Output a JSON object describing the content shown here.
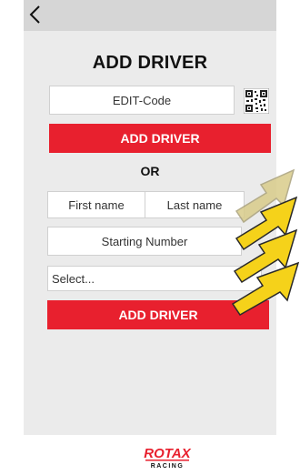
{
  "header": {
    "back_icon": "chevron-left-icon"
  },
  "page": {
    "title": "ADD DRIVER"
  },
  "edit_code": {
    "placeholder": "EDIT-Code",
    "qr_icon": "qr-code-icon"
  },
  "buttons": {
    "add_driver_top": "ADD DRIVER",
    "add_driver_bottom": "ADD DRIVER"
  },
  "separator": {
    "or": "OR"
  },
  "form": {
    "first_name": "First name",
    "last_name": "Last name",
    "starting_number": "Starting Number",
    "select_value": "Select..."
  },
  "brand": {
    "logo_text": "ROTAX",
    "sub_text": "RACING",
    "color": "#e8202e"
  },
  "colors": {
    "accent": "#e8202e",
    "arrow_fill": "#f5d21a",
    "arrow_stroke": "#2a2a2a",
    "arrow_faded": "#d9cc8a"
  }
}
